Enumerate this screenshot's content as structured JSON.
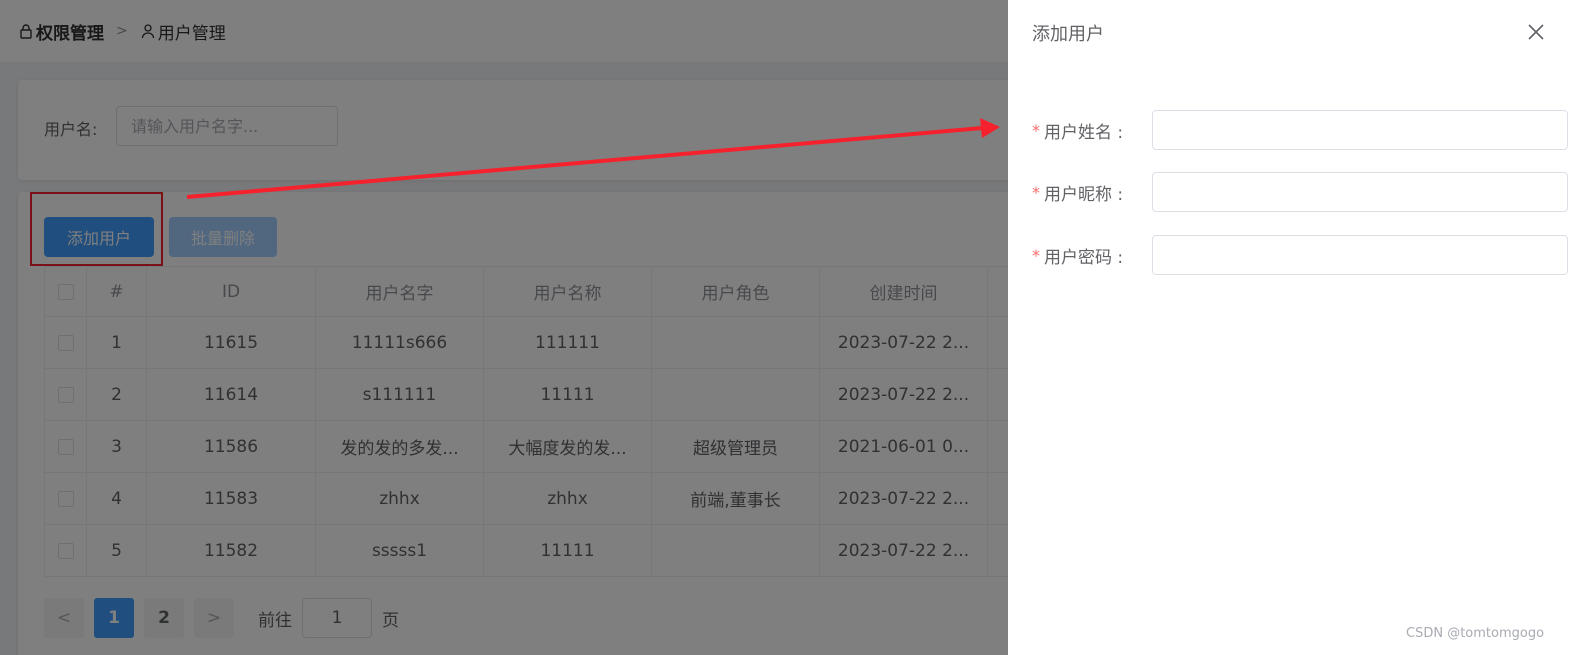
{
  "breadcrumb": {
    "first": "权限管理",
    "second": "用户管理"
  },
  "search": {
    "label": "用户名:",
    "placeholder": "请输入用户名字..."
  },
  "toolbar": {
    "add_label": "添加用户",
    "batch_delete_label": "批量删除"
  },
  "table": {
    "headers": [
      "#",
      "ID",
      "用户名字",
      "用户名称",
      "用户角色",
      "创建时间"
    ],
    "rows": [
      {
        "index": "1",
        "id": "11615",
        "username": "11111s666",
        "name": "111111",
        "role": "",
        "created": "2023-07-22 2..."
      },
      {
        "index": "2",
        "id": "11614",
        "username": "s111111",
        "name": "11111",
        "role": "",
        "created": "2023-07-22 2..."
      },
      {
        "index": "3",
        "id": "11586",
        "username": "发的发的多发...",
        "name": "大幅度发的发...",
        "role": "超级管理员",
        "created": "2021-06-01 0..."
      },
      {
        "index": "4",
        "id": "11583",
        "username": "zhhx",
        "name": "zhhx",
        "role": "前端,董事长",
        "created": "2023-07-22 2..."
      },
      {
        "index": "5",
        "id": "11582",
        "username": "sssss1",
        "name": "11111",
        "role": "",
        "created": "2023-07-22 2..."
      }
    ]
  },
  "pagination": {
    "prev": "<",
    "pages": [
      "1",
      "2"
    ],
    "next": ">",
    "goto_label": "前往",
    "goto_value": "1",
    "page_unit": "页"
  },
  "drawer": {
    "title": "添加用户",
    "fields": [
      {
        "label": "用户姓名 :"
      },
      {
        "label": "用户昵称 :"
      },
      {
        "label": "用户密码 :"
      }
    ]
  },
  "watermark": "CSDN @tomtomgogo",
  "colors": {
    "primary": "#409eff",
    "annotation": "#f5222d",
    "required": "#f56c6c"
  }
}
